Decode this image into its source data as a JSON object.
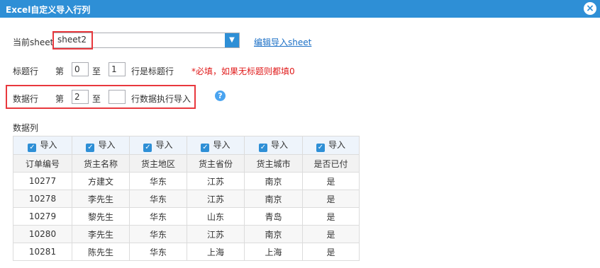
{
  "window": {
    "title": "Excel自定义导入行列"
  },
  "sheet_row": {
    "label": "当前sheet",
    "selected": "sheet2",
    "edit_link": "编辑导入sheet"
  },
  "title_row": {
    "label": "标题行",
    "prefix": "第",
    "from": "0",
    "middle": "至",
    "to": "1",
    "suffix": "行是标题行",
    "required_note": "*必填，如果无标题则都填0"
  },
  "data_row": {
    "label": "数据行",
    "prefix": "第",
    "from": "2",
    "middle": "至",
    "to": "",
    "suffix": "行数据执行导入",
    "help": "?"
  },
  "data_columns": {
    "label": "数据列",
    "import_label": "导入",
    "headers": [
      "订单编号",
      "货主名称",
      "货主地区",
      "货主省份",
      "货主城市",
      "是否已付"
    ],
    "rows": [
      [
        "10277",
        "方建文",
        "华东",
        "江苏",
        "南京",
        "是"
      ],
      [
        "10278",
        "李先生",
        "华东",
        "江苏",
        "南京",
        "是"
      ],
      [
        "10279",
        "黎先生",
        "华东",
        "山东",
        "青岛",
        "是"
      ],
      [
        "10280",
        "李先生",
        "华东",
        "江苏",
        "南京",
        "是"
      ],
      [
        "10281",
        "陈先生",
        "华东",
        "上海",
        "上海",
        "是"
      ]
    ]
  }
}
